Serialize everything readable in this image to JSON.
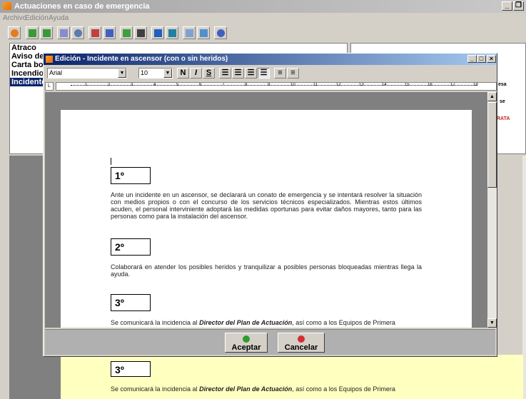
{
  "app": {
    "title": "Actuaciones en caso de emergencia",
    "window_min": "_",
    "window_restore": "❐"
  },
  "menu": [
    "Archivo",
    "Edición",
    "Ayuda"
  ],
  "left_list": {
    "items": [
      "Atraco",
      "Aviso de",
      "Carta bo",
      "Incendio",
      "Incidente"
    ],
    "selected": 4
  },
  "right_panel": {
    "snippets": [
      "esa",
      "se",
      "RATA"
    ]
  },
  "background_doc": {
    "box_label": "3º",
    "text_prefix": "Se comunicará la incidencia al ",
    "text_bold": "Director del Plan de Actuación",
    "text_suffix": ", así como a los Equipos de Primera"
  },
  "dialog": {
    "title": "Edición - Incidente en ascensor (con o sin heridos)",
    "font_name": "Arial",
    "font_size": "10",
    "buttons": {
      "bold": "N",
      "italic": "I",
      "underline": "S"
    },
    "ruler_marks": [
      "1",
      "2",
      "3",
      "4",
      "5",
      "6",
      "7",
      "8",
      "9",
      "10",
      "11",
      "12",
      "13",
      "14",
      "15",
      "16",
      "17",
      "18"
    ],
    "ruler_corner": "L",
    "sections": [
      {
        "label": "1º",
        "text": "Ante un incidente en un ascensor, se declarará un conato de emergencia y se intentará resolver la situación con medios propios o con el concurso de los servicios técnicos especializados. Mientras estos últimos acuden, el personal interviniente adoptará las medidas oportunas para evitar daños mayores, tanto para las personas como para la instalación del ascensor."
      },
      {
        "label": "2º",
        "text": "Colaborará en atender los posibles heridos y tranquilizar a posibles personas bloqueadas mientras llega la ayuda."
      },
      {
        "label": "3º",
        "text_prefix": "Se comunicará la incidencia al ",
        "text_bold": "Director del Plan de Actuación",
        "text_suffix": ", así como a los Equipos de Primera"
      }
    ],
    "accept_label": "Aceptar",
    "cancel_label": "Cancelar"
  },
  "colors": {
    "dialog_title_start": "#0a246a",
    "selection": "#0a246a",
    "accept_icon": "#2e9b2e",
    "cancel_icon": "#d22e2e",
    "doc_yellow": "#ffffc0"
  },
  "icons": [
    "exit-icon",
    "forward-icon",
    "back-icon",
    "window-icon",
    "search-icon",
    "arrow-right-icon",
    "arrow-left-icon",
    "refresh-icon",
    "binoculars-icon",
    "chart-icon",
    "chart-tree-icon",
    "window-group-icon",
    "mail-icon",
    "help-icon"
  ]
}
